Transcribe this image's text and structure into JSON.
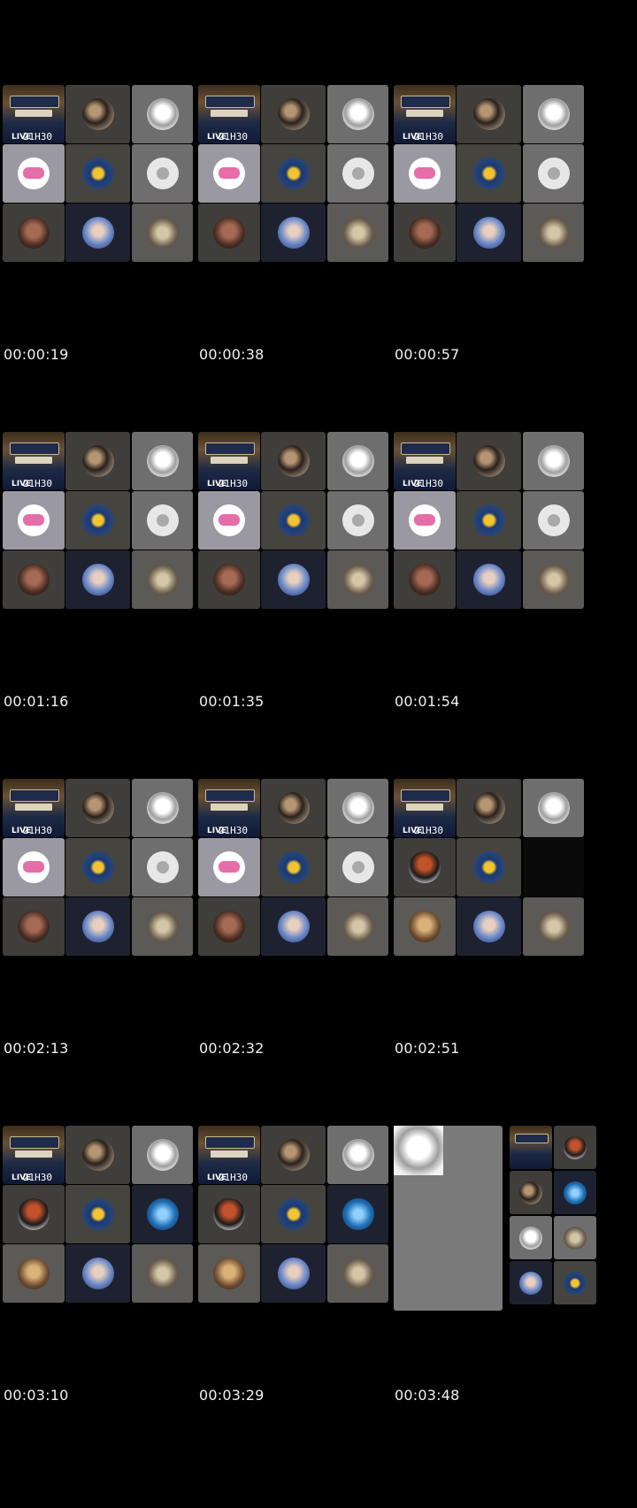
{
  "poster": {
    "live": "LIVE",
    "time": "21H30"
  },
  "frames": [
    {
      "timestamp": "00:00:19"
    },
    {
      "timestamp": "00:00:38"
    },
    {
      "timestamp": "00:00:57"
    },
    {
      "timestamp": "00:01:16"
    },
    {
      "timestamp": "00:01:35"
    },
    {
      "timestamp": "00:01:54"
    },
    {
      "timestamp": "00:02:13"
    },
    {
      "timestamp": "00:02:32"
    },
    {
      "timestamp": "00:02:51"
    },
    {
      "timestamp": "00:03:10"
    },
    {
      "timestamp": "00:03:29"
    },
    {
      "timestamp": "00:03:48"
    }
  ]
}
